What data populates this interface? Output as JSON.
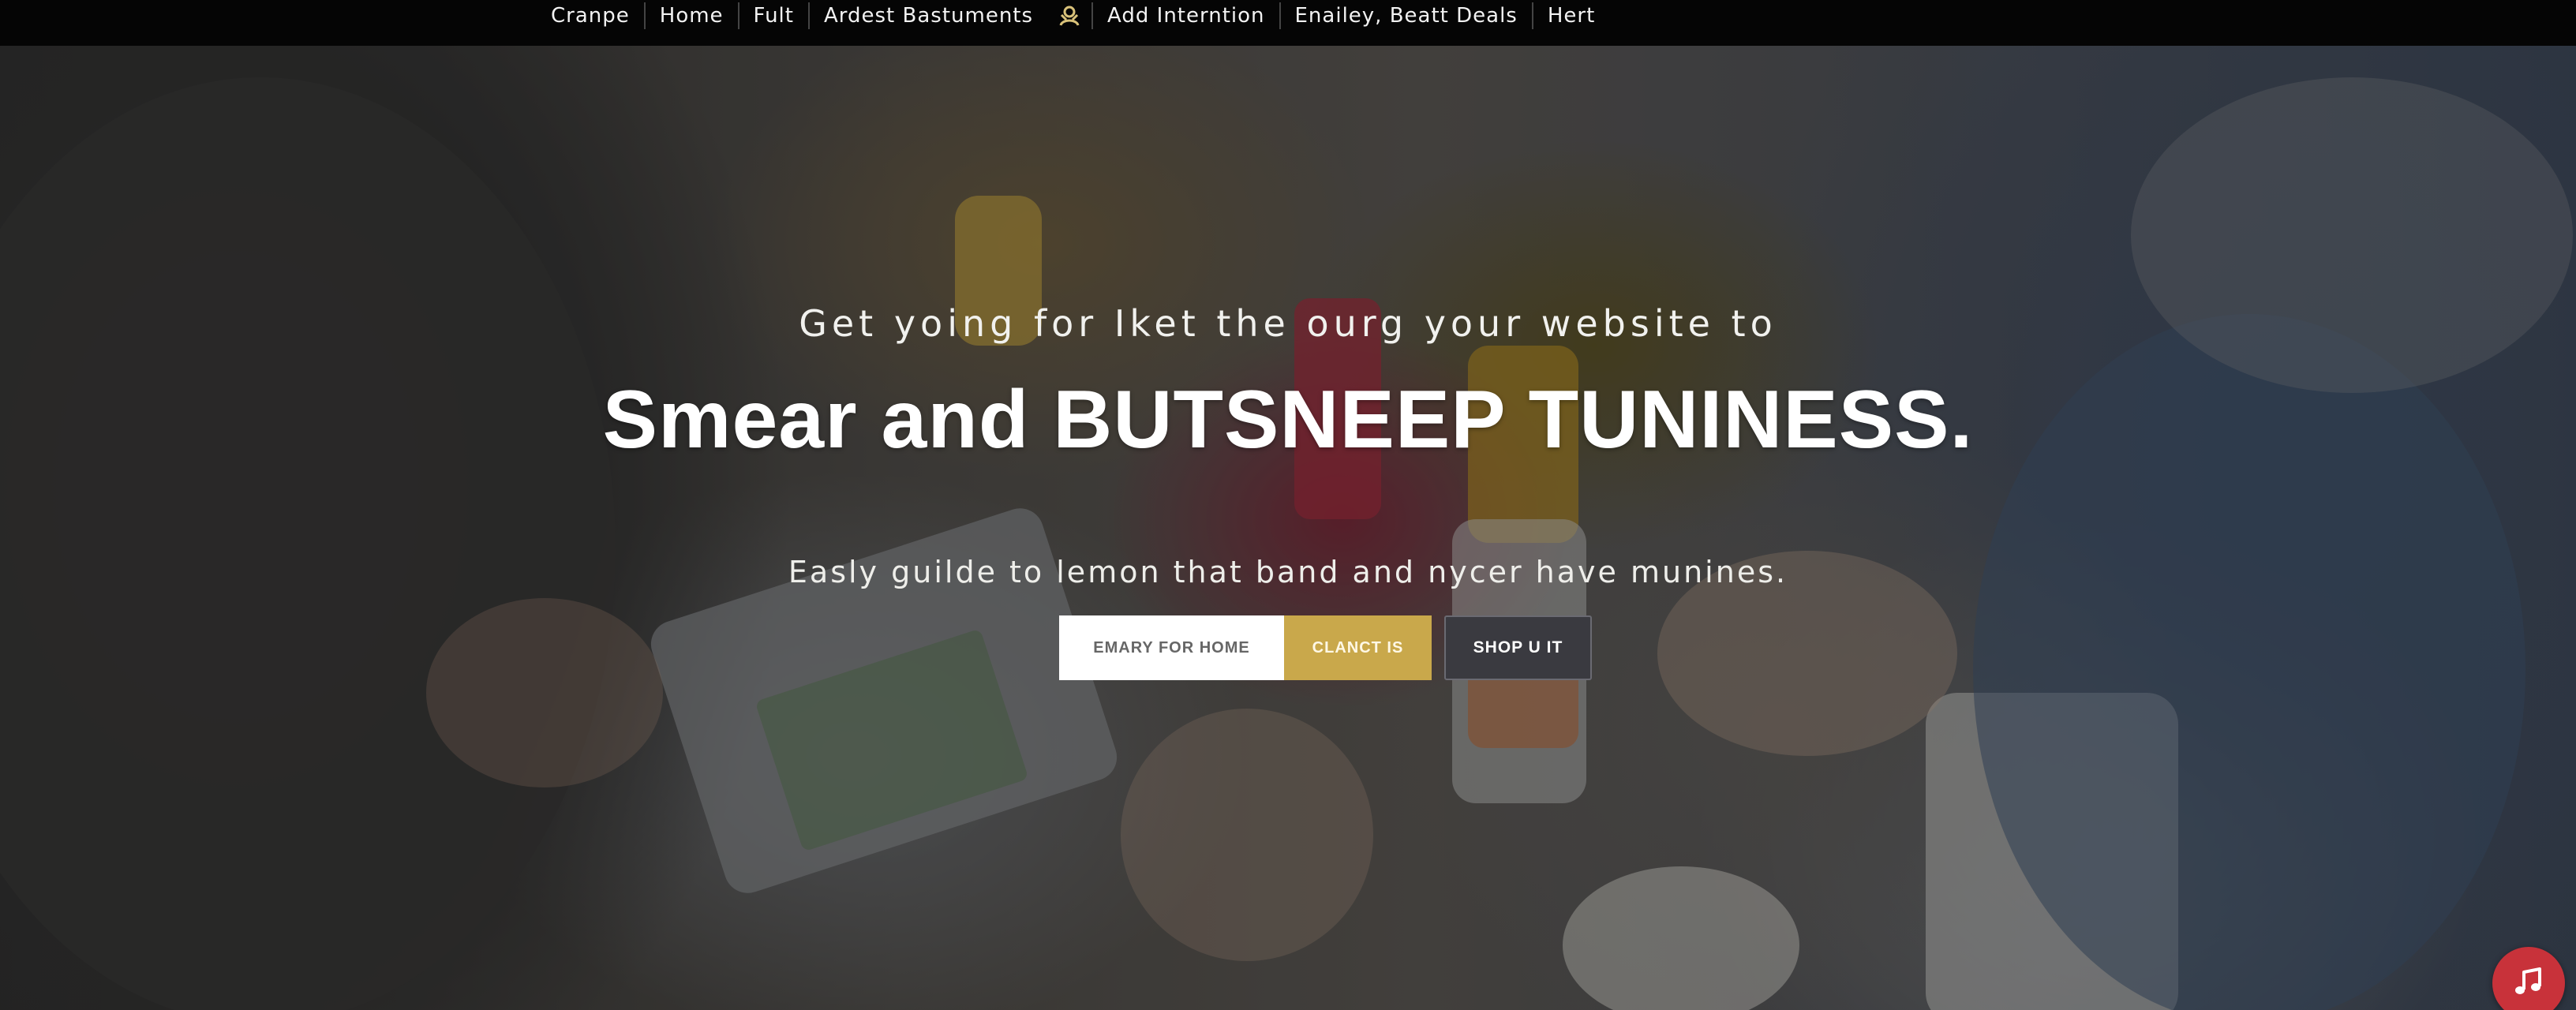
{
  "nav": {
    "items": [
      {
        "label": "Cranpe"
      },
      {
        "label": "Home"
      },
      {
        "label": "Fult"
      },
      {
        "label": "Ardest Bastuments"
      },
      {
        "label": "Add Interntion"
      },
      {
        "label": "Enailey, Beatt Deals"
      },
      {
        "label": "Hert"
      }
    ],
    "icon": "person-icon",
    "icon_color": "#d9c27a"
  },
  "hero": {
    "subtitle": "Get yoing for Iket the ourg your website to",
    "headline": "Smear and BUTSNEEP TUNINESS.",
    "tagline": "Easly guilde to lemon that band and nycer have munines.",
    "email_placeholder": "EMARY FOR HOME",
    "primary_button": "CLANCT IS",
    "secondary_button": "SHOP U IT"
  },
  "music_button": {
    "icon": "music-note-icon",
    "color": "#c8323a"
  },
  "colors": {
    "accent": "#c9a84b",
    "nav_bg": "#050505",
    "dark_button": "#3a3a40"
  }
}
